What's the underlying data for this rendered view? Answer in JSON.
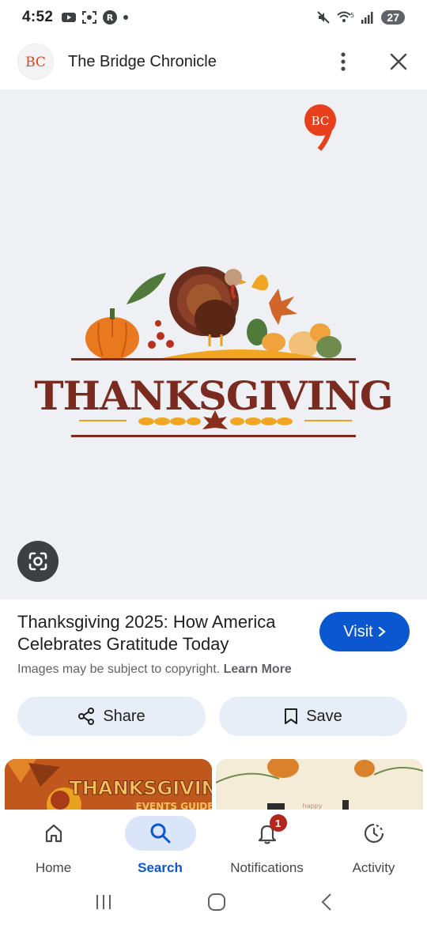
{
  "status": {
    "time": "4:52",
    "battery": "27",
    "wifi_label": "5"
  },
  "header": {
    "logo_text": "BC",
    "title": "The Bridge Chronicle"
  },
  "image": {
    "watermark": "BC",
    "headline": "THANKSGIVING"
  },
  "result": {
    "title": "Thanksgiving 2025: How America Celebrates Gratitude Today",
    "visit_label": "Visit",
    "copyright_text": "Images may be subject to copyright.",
    "learn_more": "Learn More"
  },
  "actions": {
    "share_label": "Share",
    "save_label": "Save"
  },
  "thumbnails": {
    "first_title": "THANKSGIVING",
    "first_subtitle": "EVENTS GUIDE",
    "second_text": "happy"
  },
  "bottom_nav": {
    "items": [
      {
        "label": "Home",
        "icon": "home-icon"
      },
      {
        "label": "Search",
        "icon": "search-icon"
      },
      {
        "label": "Notifications",
        "icon": "bell-icon",
        "badge": "1"
      },
      {
        "label": "Activity",
        "icon": "activity-icon"
      }
    ]
  },
  "colors": {
    "accent": "#0b57d0",
    "pill_bg": "#e8eef8",
    "image_bg": "#eff0f3",
    "brand_red": "#e8401c"
  }
}
